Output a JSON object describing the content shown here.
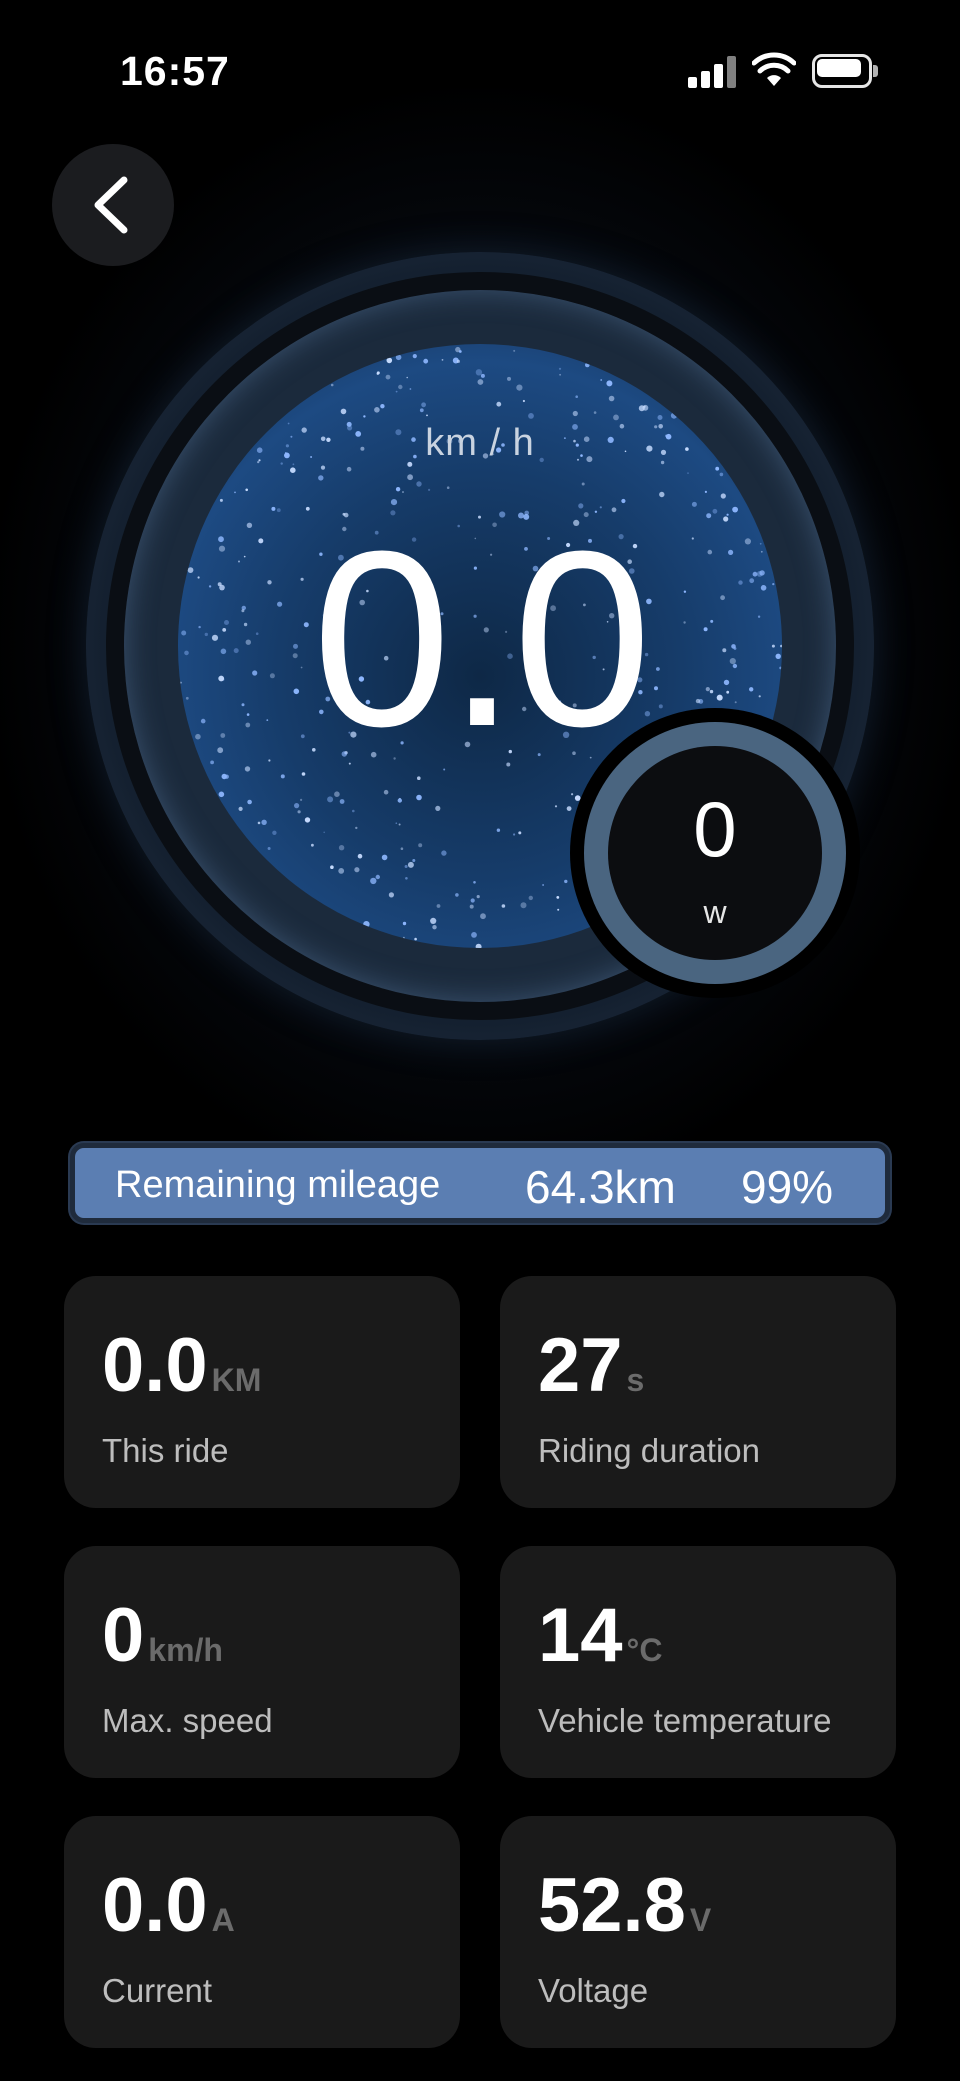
{
  "status_bar": {
    "time": "16:57",
    "icons": [
      "cellular-signal-icon",
      "wifi-icon",
      "battery-icon"
    ]
  },
  "navigation": {
    "back_icon": "chevron-left-icon"
  },
  "speedometer": {
    "unit": "km / h",
    "value": "0.0"
  },
  "power": {
    "value": "0",
    "unit": "w"
  },
  "mileage": {
    "label": "Remaining mileage",
    "value": "64.3km",
    "battery_percent": "99%",
    "battery_level": 0.99
  },
  "stats": [
    {
      "value": "0.0",
      "unit": "KM",
      "label": "This ride"
    },
    {
      "value": "27",
      "unit": "s",
      "label": "Riding duration"
    },
    {
      "value": "0",
      "unit": "km/h",
      "label": "Max. speed"
    },
    {
      "value": "14",
      "unit": "°C",
      "label": "Vehicle temperature"
    },
    {
      "value": "0.0",
      "unit": "A",
      "label": "Current"
    },
    {
      "value": "52.8",
      "unit": "V",
      "label": "Voltage"
    }
  ],
  "colors": {
    "background": "#000000",
    "card": "#1a1a1a",
    "mileage_bar": "#5b7eb2",
    "gauge_blue": "#1d4a82"
  }
}
